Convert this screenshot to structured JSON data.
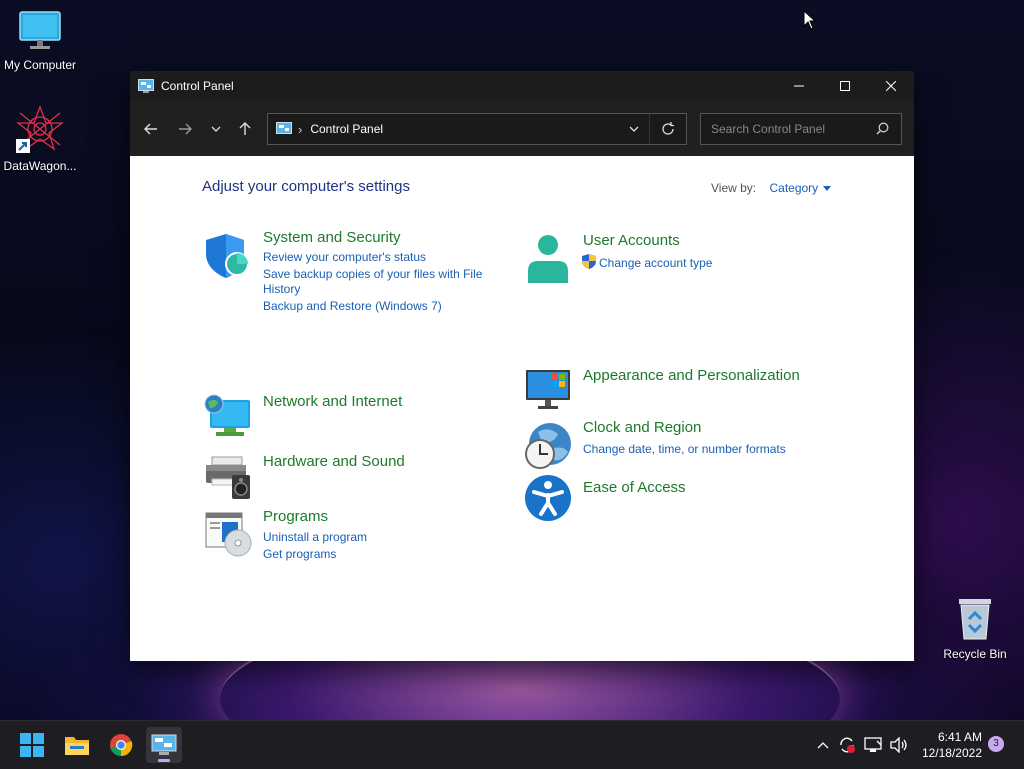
{
  "desktop": {
    "icons": [
      {
        "label": "My Computer"
      },
      {
        "label": "DataWagon..."
      },
      {
        "label": "Recycle Bin"
      }
    ]
  },
  "window": {
    "title": "Control Panel",
    "address": {
      "crumb": "Control Panel"
    },
    "search": {
      "placeholder": "Search Control Panel"
    },
    "heading": "Adjust your computer's settings",
    "view_by": {
      "label": "View by:",
      "value": "Category"
    },
    "categories": [
      {
        "title": "System and Security",
        "links": [
          "Review your computer's status",
          "Save backup copies of your files with File",
          "History",
          "Backup and Restore (Windows 7)"
        ]
      },
      {
        "title": "Network and Internet",
        "links": []
      },
      {
        "title": "Hardware and Sound",
        "links": []
      },
      {
        "title": "Programs",
        "links": [
          "Uninstall a program",
          "Get programs"
        ]
      },
      {
        "title": "User Accounts",
        "links": [
          "Change account type"
        ]
      },
      {
        "title": "Appearance and Personalization",
        "links": []
      },
      {
        "title": "Clock and Region",
        "links": [
          "Change date, time, or number formats"
        ]
      },
      {
        "title": "Ease of Access",
        "links": []
      }
    ]
  },
  "taskbar": {
    "clock": {
      "time": "6:41 AM",
      "date": "12/18/2022"
    },
    "notification_count": "3"
  },
  "colors": {
    "category_title": "#1c7a2c",
    "link": "#1a5fb4",
    "heading": "#1e3287"
  }
}
